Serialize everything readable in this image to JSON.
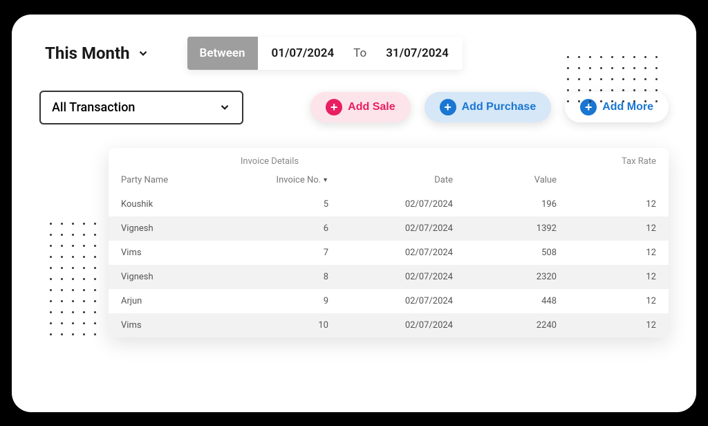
{
  "period": {
    "label": "This Month",
    "between_label": "Between",
    "from": "01/07/2024",
    "to_label": "To",
    "to": "31/07/2024"
  },
  "filter": {
    "transaction_label": "All Transaction"
  },
  "actions": {
    "add_sale": "Add Sale",
    "add_purchase": "Add Purchase",
    "add_more": "Add More"
  },
  "table": {
    "group_invoice": "Invoice Details",
    "group_tax": "Tax Rate",
    "headers": {
      "party": "Party Name",
      "invoice": "Invoice No.",
      "date": "Date",
      "value": "Value"
    },
    "rows": [
      {
        "party": "Koushik",
        "invoice": "5",
        "date": "02/07/2024",
        "value": "196",
        "tax": "12"
      },
      {
        "party": "Vignesh",
        "invoice": "6",
        "date": "02/07/2024",
        "value": "1392",
        "tax": "12"
      },
      {
        "party": "Vims",
        "invoice": "7",
        "date": "02/07/2024",
        "value": "508",
        "tax": "12"
      },
      {
        "party": "Vignesh",
        "invoice": "8",
        "date": "02/07/2024",
        "value": "2320",
        "tax": "12"
      },
      {
        "party": "Arjun",
        "invoice": "9",
        "date": "02/07/2024",
        "value": "448",
        "tax": "12"
      },
      {
        "party": "Vims",
        "invoice": "10",
        "date": "02/07/2024",
        "value": "2240",
        "tax": "12"
      }
    ]
  }
}
